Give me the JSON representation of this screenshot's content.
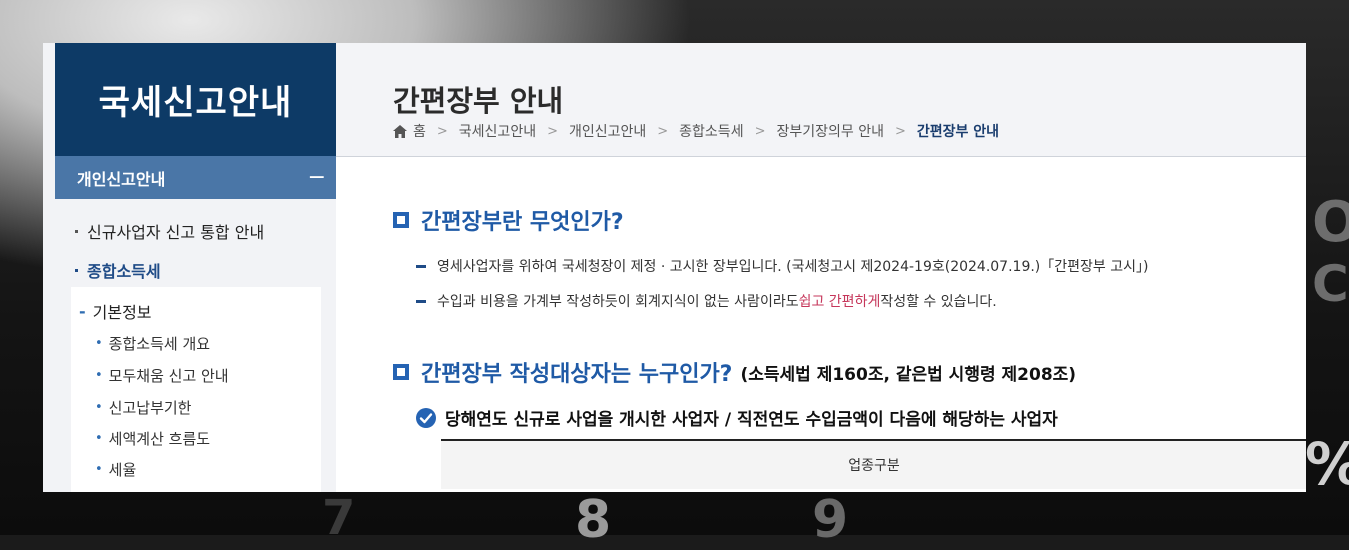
{
  "sidebar": {
    "title": "국세신고안내",
    "section": {
      "label": "개인신고안내",
      "toggle": "−"
    },
    "items": [
      {
        "label": "신규사업자 신고 통합 안내"
      },
      {
        "label": "종합소득세"
      }
    ],
    "sub_menu": {
      "heading": "기본정보",
      "items": [
        {
          "label": "종합소득세 개요"
        },
        {
          "label": "모두채움 신고 안내"
        },
        {
          "label": "신고납부기한"
        },
        {
          "label": "세액계산 흐름도"
        },
        {
          "label": "세율"
        }
      ]
    }
  },
  "header": {
    "title": "간편장부 안내",
    "breadcrumb": [
      "홈",
      "국세신고안내",
      "개인신고안내",
      "종합소득세",
      "장부기장의무 안내",
      "간편장부 안내"
    ]
  },
  "content": {
    "section1": {
      "heading": "간편장부란 무엇인가?",
      "line1": "영세사업자를 위하여 국세청장이 제정 · 고시한 장부입니다. (국세청고시 제2024-19호(2024.07.19.)「간편장부 고시」)",
      "line2_before": "수입과 비용을 가계부 작성하듯이 회계지식이 없는 사람이라도 ",
      "line2_highlight": "쉽고 간편하게",
      "line2_after": " 작성할 수 있습니다."
    },
    "section2": {
      "heading": "간편장부 작성대상자는 누구인가?",
      "heading_sub": "(소득세법 제160조, 같은법 시행령 제208조)",
      "check_text": "당해연도 신규로 사업을 개시한 사업자 / 직전연도 수입금액이 다음에 해당하는 사업자",
      "table_header": "업종구분"
    }
  },
  "background_keys": [
    "O",
    "CE",
    "%",
    "7",
    "8",
    "9"
  ],
  "colors": {
    "sidebar_title_bg": "#0d3a66",
    "section_bar_bg": "#4a76a7",
    "heading_blue": "#1f5aa6",
    "highlight_red": "#c6375b"
  }
}
